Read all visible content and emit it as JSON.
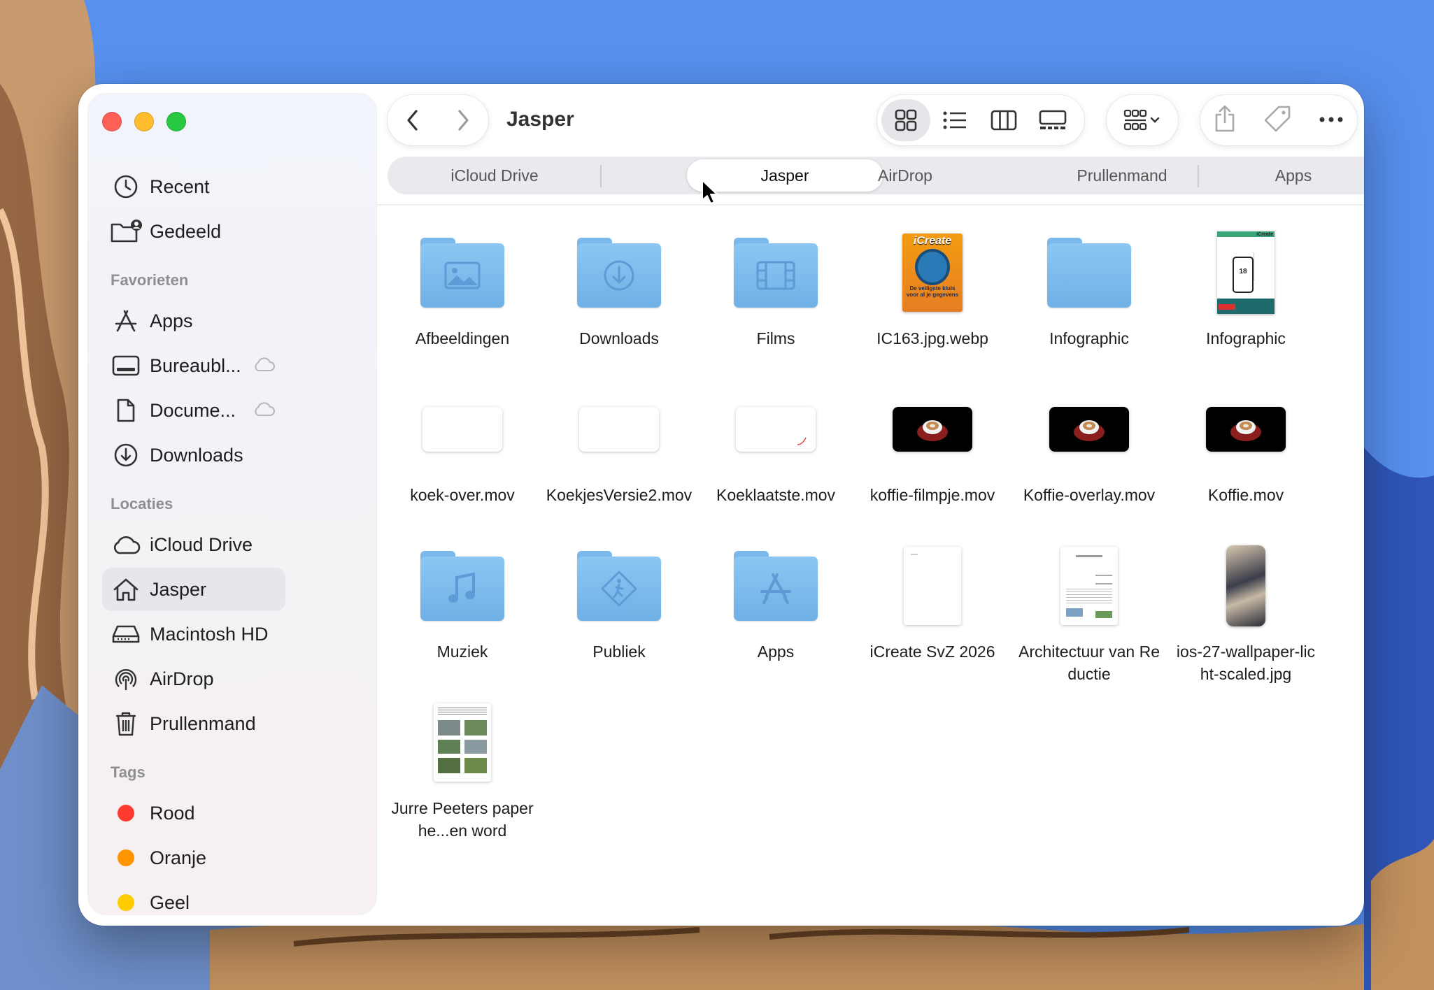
{
  "window": {
    "title": "Jasper"
  },
  "sidebar": {
    "top_items": [
      {
        "label": "Recent",
        "icon": "clock-icon"
      },
      {
        "label": "Gedeeld",
        "icon": "shared-folder-icon"
      }
    ],
    "favorites_title": "Favorieten",
    "favorites": [
      {
        "label": "Apps",
        "icon": "apps-icon"
      },
      {
        "label": "Bureaubl...",
        "icon": "desktop-icon",
        "cloud": true
      },
      {
        "label": "Docume...",
        "icon": "document-icon",
        "cloud": true
      },
      {
        "label": "Downloads",
        "icon": "download-icon"
      }
    ],
    "locations_title": "Locaties",
    "locations": [
      {
        "label": "iCloud Drive",
        "icon": "cloud-icon"
      },
      {
        "label": "Jasper",
        "icon": "home-icon",
        "active": true
      },
      {
        "label": "Macintosh HD",
        "icon": "disk-icon"
      },
      {
        "label": "AirDrop",
        "icon": "airdrop-icon"
      },
      {
        "label": "Prullenmand",
        "icon": "trash-icon"
      }
    ],
    "tags_title": "Tags",
    "tags": [
      {
        "label": "Rood",
        "color": "#ff3b30"
      },
      {
        "label": "Oranje",
        "color": "#ff9500"
      },
      {
        "label": "Geel",
        "color": "#ffcc00"
      }
    ]
  },
  "tabs": [
    {
      "label": "iCloud Drive"
    },
    {
      "label": "Jasper",
      "active": true
    },
    {
      "label": "AirDrop"
    },
    {
      "label": "Prullenmand"
    },
    {
      "label": "Apps"
    }
  ],
  "files": [
    {
      "name": "Afbeeldingen",
      "kind": "folder",
      "glyph": "photo-icon"
    },
    {
      "name": "Downloads",
      "kind": "folder",
      "glyph": "download-icon"
    },
    {
      "name": "Films",
      "kind": "folder",
      "glyph": "film-icon"
    },
    {
      "name": "IC163.jpg.webp",
      "kind": "magazine"
    },
    {
      "name": "Infographic",
      "kind": "folder",
      "glyph": ""
    },
    {
      "name": "Infographic",
      "kind": "infographic"
    },
    {
      "name": "koek-over.mov",
      "kind": "mov-white"
    },
    {
      "name": "KoekjesVersie2.mov",
      "kind": "mov-white"
    },
    {
      "name": "Koeklaatste.mov",
      "kind": "mov-white"
    },
    {
      "name": "koffie-filmpje.mov",
      "kind": "mov-black"
    },
    {
      "name": "Koffie-overlay.mov",
      "kind": "mov-black"
    },
    {
      "name": "Koffie.mov",
      "kind": "mov-black"
    },
    {
      "name": "Muziek",
      "kind": "folder",
      "glyph": "music-icon"
    },
    {
      "name": "Publiek",
      "kind": "folder",
      "glyph": "public-icon"
    },
    {
      "name": "Apps",
      "kind": "folder",
      "glyph": "apps-icon"
    },
    {
      "name": "iCreate SvZ 2026",
      "kind": "doc-blank"
    },
    {
      "name": "Architectuur van Reductie",
      "kind": "doc-text"
    },
    {
      "name": "ios-27-wallpaper-licht-scaled.jpg",
      "kind": "wallpaper"
    },
    {
      "name": "Jurre Peeters paper he...en word",
      "kind": "doc-photos"
    }
  ],
  "magazine_cover": {
    "brand": "iCreate",
    "headline": "De veiligste kluis voor al je gegevens"
  },
  "infographic_cover": {
    "brand": "iCreate",
    "number": "18"
  }
}
